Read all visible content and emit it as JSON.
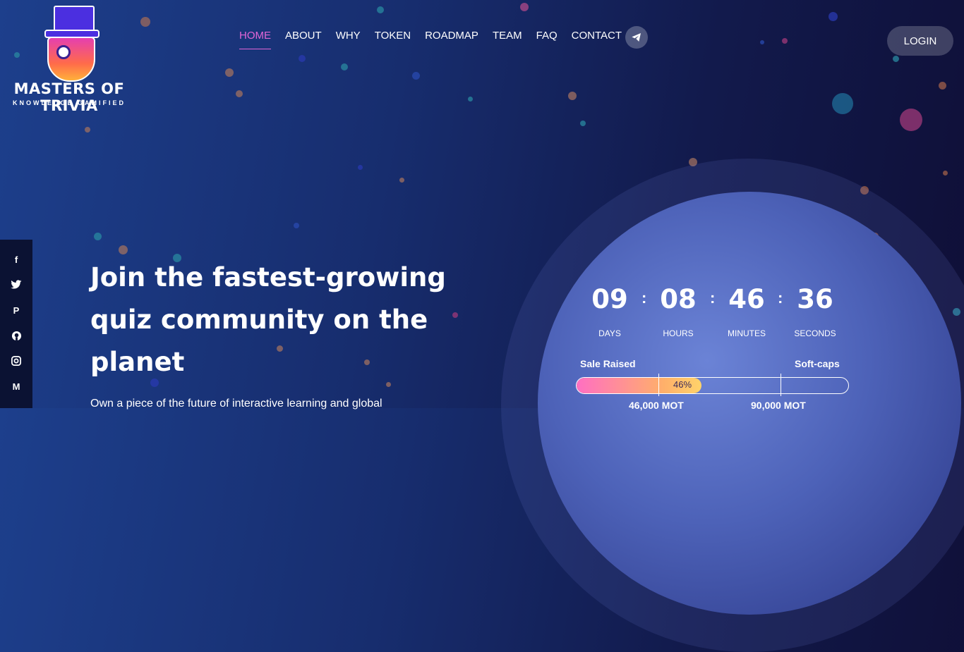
{
  "brand": {
    "name": "MASTERS OF TRIVIA",
    "tagline": "KNOWLEDGE GAMIFIED"
  },
  "nav": {
    "items": [
      {
        "label": "HOME",
        "active": true
      },
      {
        "label": "ABOUT",
        "active": false
      },
      {
        "label": "WHY",
        "active": false
      },
      {
        "label": "TOKEN",
        "active": false
      },
      {
        "label": "ROADMAP",
        "active": false
      },
      {
        "label": "TEAM",
        "active": false
      },
      {
        "label": "FAQ",
        "active": false
      },
      {
        "label": "CONTACT",
        "active": false
      }
    ],
    "telegram_icon": "telegram-icon",
    "login_label": "LOGIN"
  },
  "social": {
    "icons": [
      "facebook-icon",
      "twitter-icon",
      "pinterest-icon",
      "github-icon",
      "instagram-icon",
      "medium-icon"
    ]
  },
  "hero": {
    "title": "Join the fastest-growing quiz community on the planet",
    "subtitle": "Own a piece of the future of interactive learning and global"
  },
  "countdown": {
    "days": "09",
    "hours": "08",
    "minutes": "46",
    "seconds": "36",
    "days_label": "DAYS",
    "hours_label": "HOURS",
    "minutes_label": "MINUTES",
    "seconds_label": "SECONDS"
  },
  "sale": {
    "raised_label": "Sale Raised",
    "softcaps_label": "Soft-caps",
    "progress_percent": 46,
    "progress_label": "46%",
    "cap1": "46,000 MOT",
    "cap2": "90,000 MOT"
  },
  "colors": {
    "accent": "#e266d6",
    "progress_start": "#ff6fc2",
    "progress_end": "#ffd36a"
  }
}
